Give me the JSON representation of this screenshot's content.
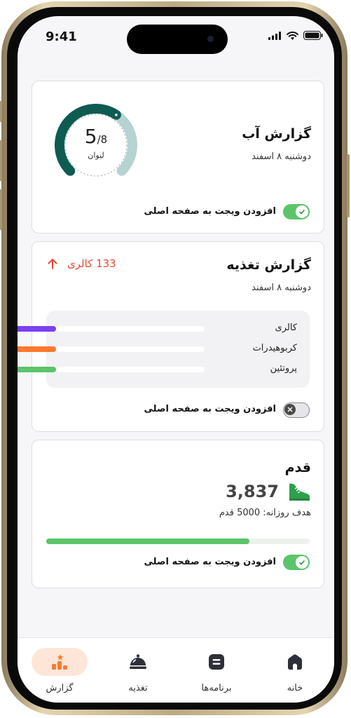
{
  "status": {
    "time": "9:41"
  },
  "water": {
    "title": "گزارش آب",
    "date": "دوشنبه ۸ اسفند",
    "count": "5",
    "total": "/8",
    "unit": "لیوان",
    "progress": 0.625,
    "widget_label": "افزودن ویجت به صفحه اصلی",
    "widget_on": true,
    "colors": {
      "primary": "#0e5b52",
      "secondary": "#b4d3d1"
    }
  },
  "nutrition": {
    "title": "گزارش تغذیه",
    "date": "دوشنبه ۸ اسفند",
    "calories": "133 کالری",
    "rows": [
      {
        "label": "کالری",
        "color": "#7b3ff2",
        "progress": 0.85
      },
      {
        "label": "کربوهیدرات",
        "color": "#ff7a2e",
        "progress": 0.85
      },
      {
        "label": "پروتئین",
        "color": "#5cc46a",
        "progress": 0.85
      }
    ],
    "widget_label": "افزودن ویجت به صفحه اصلی",
    "widget_on": false
  },
  "steps": {
    "title": "قدم",
    "value": "3,837",
    "goal": "هدف روزانه: 5000 قدم",
    "progress": 0.77,
    "widget_label": "افزودن ویجت به صفحه اصلی",
    "widget_on": true
  },
  "tabs": [
    {
      "label": "خانه",
      "icon": "home-icon",
      "active": false
    },
    {
      "label": "برنامه‌ها",
      "icon": "list-icon",
      "active": false
    },
    {
      "label": "تغذیه",
      "icon": "food-icon",
      "active": false
    },
    {
      "label": "گزارش",
      "icon": "report-icon",
      "active": true
    }
  ],
  "accent": "#fde6d8"
}
